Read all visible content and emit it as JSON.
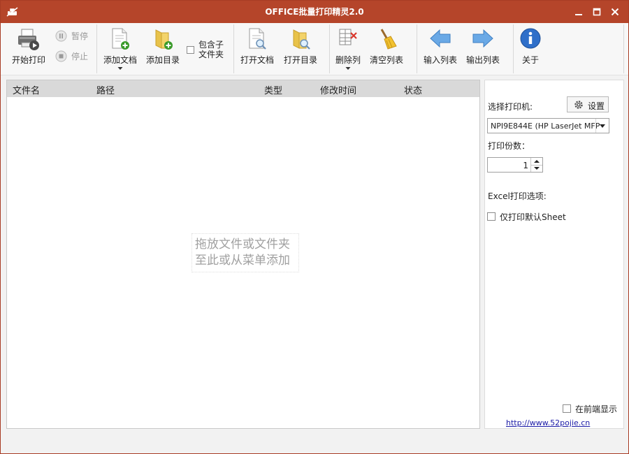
{
  "window": {
    "title": "OFFICE批量打印精灵2.0",
    "accent_color": "#b5452a",
    "controls": [
      "minimize-icon",
      "maximize-icon",
      "close-icon"
    ]
  },
  "toolbar": {
    "start_print": "开始打印",
    "pause": "暂停",
    "stop": "停止",
    "add_document": "添加文档",
    "add_directory": "添加目录",
    "include_subfolder_line1": "包含子",
    "include_subfolder_line2": "文件夹",
    "include_subfolder_checked": false,
    "open_document": "打开文档",
    "open_directory": "打开目录",
    "delete_column": "删除列",
    "clear_list": "清空列表",
    "import_list": "输入列表",
    "export_list": "输出列表",
    "about": "关于"
  },
  "file_list": {
    "columns": [
      "文件名",
      "路径",
      "类型",
      "修改时间",
      "状态"
    ],
    "rows": [],
    "empty_hint_line1": "拖放文件或文件夹",
    "empty_hint_line2": "至此或从菜单添加"
  },
  "side_panel": {
    "select_printer_label": "选择打印机:",
    "settings_button": "设置",
    "printer_value": "NPI9E844E (HP LaserJet MFP",
    "copies_label": "打印份数：",
    "copies_value": "1",
    "excel_options_label": "Excel打印选项:",
    "default_sheet_only": "仅打印默认Sheet",
    "default_sheet_only_checked": false,
    "always_on_top": "在前端显示",
    "always_on_top_checked": false,
    "link_text": "http://www.52pojie.cn"
  }
}
